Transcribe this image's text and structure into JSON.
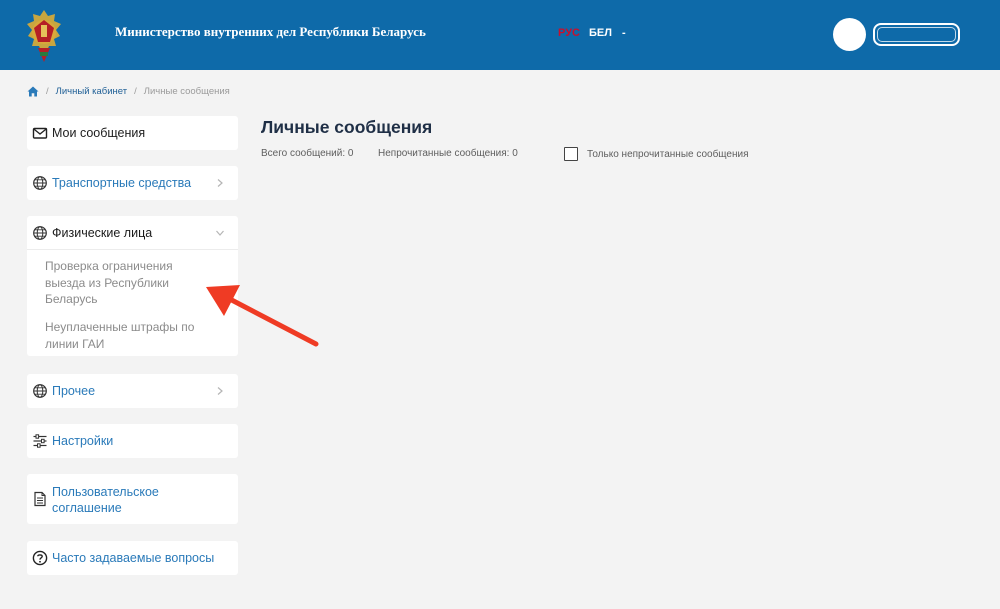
{
  "header": {
    "ministry_title": "Министерство внутренних дел Республики Беларусь",
    "lang_ru": "РУС",
    "lang_be": "БЕЛ",
    "lang_dash": "-",
    "icons": [
      "emblem-logo",
      "user-avatar"
    ]
  },
  "breadcrumb": {
    "home_icon": "home-icon",
    "items": [
      "Личный кабинет",
      "Личные сообщения"
    ],
    "separator": "/"
  },
  "sidebar": {
    "my_messages": "Мои сообщения",
    "vehicles": "Транспортные средства",
    "individuals": "Физические лица",
    "individuals_sub": [
      "Проверка ограничения выезда из Республики Беларусь",
      "Неуплаченные штрафы по линии ГАИ"
    ],
    "other": "Прочее",
    "settings": "Настройки",
    "user_agreement": "Пользовательское соглашение",
    "faq": "Часто задаваемые вопросы"
  },
  "main": {
    "title": "Личные сообщения",
    "total_messages": "Всего сообщений: 0",
    "unread_messages": "Непрочитанные сообщения: 0",
    "unread_only_label": "Только непрочитанные сообщения",
    "unread_only_checked": false
  },
  "colors": {
    "header_bg": "#0e6aa9",
    "link": "#2a7ab9",
    "accent_lang": "#c8102e",
    "annotation_arrow": "#ef3b24"
  }
}
